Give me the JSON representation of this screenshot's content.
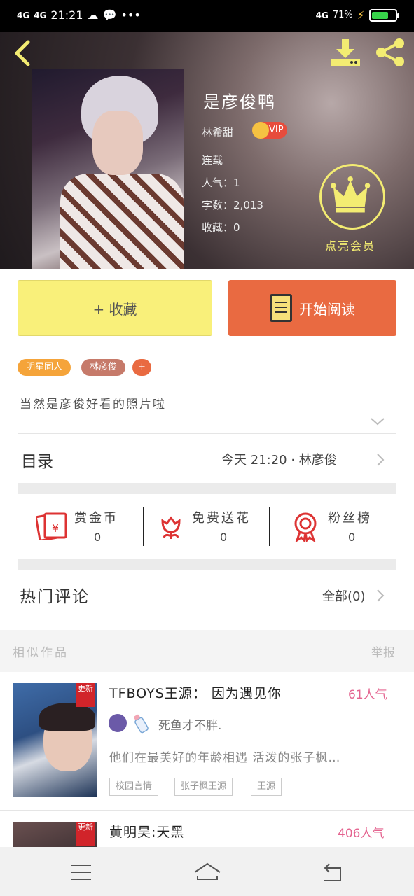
{
  "status_bar": {
    "signal1": "4G",
    "signal2": "4G",
    "time": "21:21",
    "dots": "•••",
    "signal3": "4G",
    "battery_percent": "71%",
    "battery_level": 0.71
  },
  "book": {
    "title": "是彦俊鸭",
    "author": "林希甜",
    "vip_label": "VIP",
    "status": "连载",
    "popularity_label": "人气：",
    "popularity_value": "1",
    "words_label": "字数：",
    "words_value": "2,013",
    "favorites_label": "收藏：",
    "favorites_value": "0",
    "member_label": "点亮会员"
  },
  "actions": {
    "collect_label": "+ 收藏",
    "read_label": "开始阅读"
  },
  "tags": [
    {
      "label": "明星同人",
      "color": "#f5a43a"
    },
    {
      "label": "林彦俊",
      "color": "#c67a6a"
    },
    {
      "label": "+",
      "color": "#e96a41"
    }
  ],
  "description": "当然是彦俊好看的照片啦",
  "catalog": {
    "title": "目录",
    "updated": "今天 21:20 · 林彦俊"
  },
  "stats": [
    {
      "label": "赏金币",
      "value": "0",
      "icon": "red-envelope-icon"
    },
    {
      "label": "免费送花",
      "value": "0",
      "icon": "flower-icon"
    },
    {
      "label": "粉丝榜",
      "value": "0",
      "icon": "medal-icon"
    }
  ],
  "comments": {
    "title": "热门评论",
    "all_label": "全部(0)"
  },
  "similar": {
    "title": "相似作品",
    "report_label": "举报",
    "works": [
      {
        "new_badge": "更新",
        "title": "TFBOYS王源： 因为遇见你",
        "popularity": "61人气",
        "author": "死鱼才不胖.",
        "summary": "他们在最美好的年龄相遇 活泼的张子枫…",
        "tags": [
          "校园言情",
          "张子枫王源",
          "王源"
        ]
      },
      {
        "new_badge": "更新",
        "title": "黄明昊:天黑",
        "popularity": "406人气"
      }
    ]
  },
  "colors": {
    "collect_bg": "#f9f07a",
    "read_bg": "#e96a41",
    "accent_pink": "#e4638f",
    "crown_yellow": "#f3ec72"
  }
}
